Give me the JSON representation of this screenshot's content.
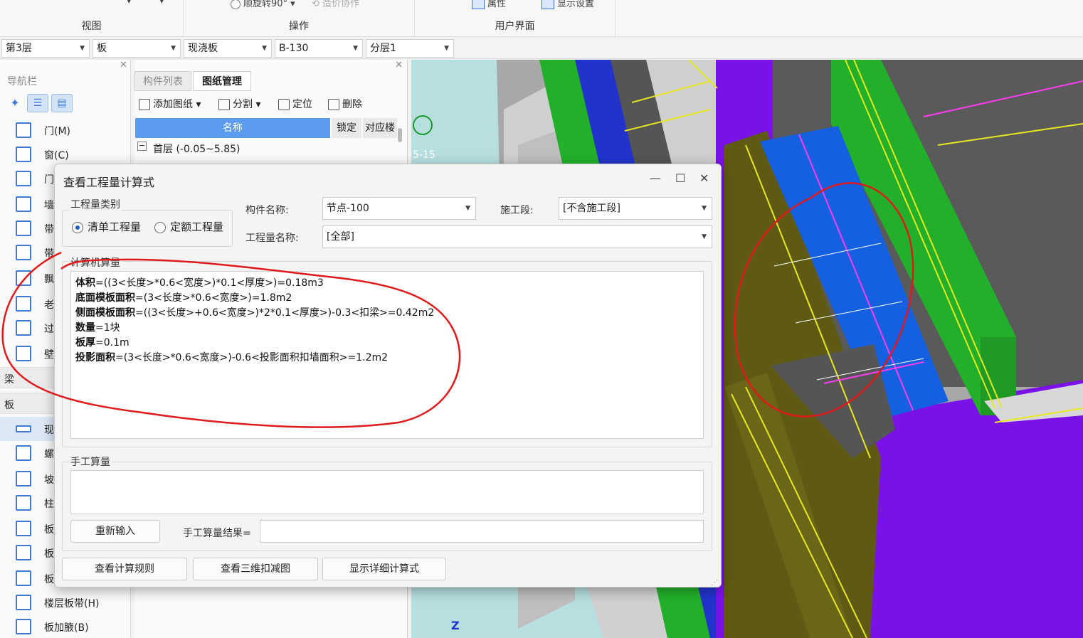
{
  "ribbon": {
    "groups": [
      {
        "name": "视图"
      },
      {
        "name": "操作",
        "top_items": [
          "顺旋转90°",
          "造价协作"
        ]
      },
      {
        "name": "用户界面",
        "top_items": [
          "属性",
          "显示设置"
        ]
      }
    ]
  },
  "selectors": [
    "第3层",
    "板",
    "现浇板",
    "B-130",
    "分层1"
  ],
  "nav": {
    "title": "导航栏",
    "items_top": [
      "门(M)",
      "窗(C)",
      "门",
      "墙",
      "带",
      "带",
      "飘",
      "老",
      "过",
      "壁"
    ],
    "section_beam": "梁",
    "section_slab": "板",
    "items_slab": [
      "现",
      "螺",
      "坡",
      "柱",
      "板",
      "板",
      "板",
      "楼层板带(H)",
      "板加腋(B)"
    ]
  },
  "drawing_panel": {
    "tabs": [
      "构件列表",
      "图纸管理"
    ],
    "toolbar": {
      "add": "添加图纸",
      "split": "分割",
      "locate": "定位",
      "delete": "删除"
    },
    "columns": [
      "名称",
      "锁定",
      "对应楼"
    ],
    "row": "首层 (-0.05~5.85)"
  },
  "viewport": {
    "label": "5-15",
    "axis": "Z"
  },
  "dialog": {
    "title": "查看工程量计算式",
    "type_group": {
      "legend": "工程量类别",
      "opt1": "清单工程量",
      "opt2": "定额工程量",
      "selected": "清单工程量"
    },
    "component_label": "构件名称:",
    "component_value": "节点-100",
    "stage_label": "施工段:",
    "stage_value": "[不含施工段]",
    "qty_label": "工程量名称:",
    "qty_value": "[全部]",
    "computed": {
      "legend": "计算机算量",
      "lines": [
        {
          "name": "体积",
          "expr": "=((3<长度>*0.6<宽度>)*0.1<厚度>)=0.18m3"
        },
        {
          "name": "底面模板面积",
          "expr": "=(3<长度>*0.6<宽度>)=1.8m2"
        },
        {
          "name": "侧面模板面积",
          "expr": "=((3<长度>+0.6<宽度>)*2*0.1<厚度>)-0.3<扣梁>=0.42m2"
        },
        {
          "name": "数量",
          "expr": "=1块"
        },
        {
          "name": "板厚",
          "expr": "=0.1m"
        },
        {
          "name": "投影面积",
          "expr": "=(3<长度>*0.6<宽度>)-0.6<投影面积扣墙面积>=1.2m2"
        }
      ]
    },
    "manual": {
      "legend": "手工算量",
      "reenter": "重新输入",
      "result_label": "手工算量结果="
    },
    "buttons": {
      "rules": "查看计算规则",
      "view3d": "查看三维扣减图",
      "detail": "显示详细计算式"
    }
  },
  "colors": {
    "annotation": "#e0191b",
    "accent": "#1a5fd1",
    "purple": "#7a12e8",
    "blue_slab": "#1560e0",
    "green": "#22b02a",
    "olive": "#5e5a14"
  }
}
